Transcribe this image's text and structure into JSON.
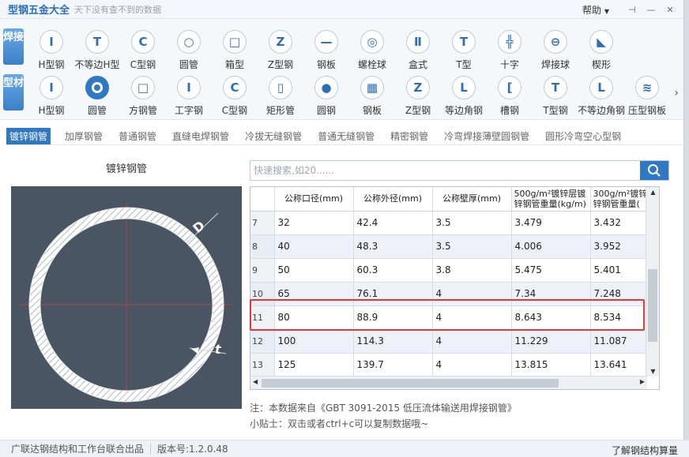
{
  "app": {
    "title": "型钢五金大全",
    "slogan": "天下没有查不到的数据",
    "help": "帮助",
    "help_arrow": "▼"
  },
  "categories": {
    "weld": "焊接",
    "profile": "型材"
  },
  "weld_items": [
    {
      "label": "H型钢",
      "icon": "I"
    },
    {
      "label": "不等边H型",
      "icon": "T"
    },
    {
      "label": "C型钢",
      "icon": "C"
    },
    {
      "label": "圆管",
      "icon": "○"
    },
    {
      "label": "箱型",
      "icon": "□"
    },
    {
      "label": "Z型钢",
      "icon": "Z"
    },
    {
      "label": "钢板",
      "icon": "—"
    },
    {
      "label": "螺栓球",
      "icon": "◎"
    },
    {
      "label": "盒式",
      "icon": "Ⅱ"
    },
    {
      "label": "T型",
      "icon": "T"
    },
    {
      "label": "十字",
      "icon": "╬"
    },
    {
      "label": "焊接球",
      "icon": "⊖"
    },
    {
      "label": "楔形",
      "icon": "◣"
    }
  ],
  "profile_items": [
    {
      "label": "H型钢",
      "icon": "I"
    },
    {
      "label": "圆管",
      "icon": "○"
    },
    {
      "label": "方钢管",
      "icon": "□"
    },
    {
      "label": "工字钢",
      "icon": "I"
    },
    {
      "label": "C型钢",
      "icon": "C"
    },
    {
      "label": "矩形管",
      "icon": "▯"
    },
    {
      "label": "圆钢",
      "icon": "●"
    },
    {
      "label": "钢板",
      "icon": "▦"
    },
    {
      "label": "Z型钢",
      "icon": "Z"
    },
    {
      "label": "等边角钢",
      "icon": "L"
    },
    {
      "label": "槽钢",
      "icon": "["
    },
    {
      "label": "T型钢",
      "icon": "T"
    },
    {
      "label": "不等边角钢",
      "icon": "L"
    },
    {
      "label": "压型钢板",
      "icon": "≋"
    }
  ],
  "subtabs": [
    "镀锌钢管",
    "加厚钢管",
    "普通钢管",
    "直缝电焊钢管",
    "冷拔无缝钢管",
    "普通无缝钢管",
    "精密钢管",
    "冷弯焊接薄壁圆钢管",
    "圆形冷弯空心型钢"
  ],
  "panel_title": "镀锌钢管",
  "diagram": {
    "label_d": "D",
    "label_t": "t"
  },
  "search": {
    "placeholder": "快速搜索,如20......"
  },
  "table": {
    "headers": [
      "公称口径(mm)",
      "公称外径(mm)",
      "公称壁厚(mm)",
      "500g/m²镀锌层镀|锌钢管重量(kg/m)",
      "300g/m²镀锌|锌钢管重量("
    ],
    "rows": [
      [
        "7",
        "32",
        "42.4",
        "3.5",
        "3.479",
        "3.432"
      ],
      [
        "8",
        "40",
        "48.3",
        "3.5",
        "4.006",
        "3.952"
      ],
      [
        "9",
        "50",
        "60.3",
        "3.8",
        "5.475",
        "5.401"
      ],
      [
        "10",
        "65",
        "76.1",
        "4",
        "7.34",
        "7.248"
      ],
      [
        "11",
        "80",
        "88.9",
        "4",
        "8.643",
        "8.534"
      ],
      [
        "12",
        "100",
        "114.3",
        "4",
        "11.229",
        "11.087"
      ],
      [
        "13",
        "125",
        "139.7",
        "4",
        "13.815",
        "13.641"
      ]
    ]
  },
  "notes": {
    "source": "注：本数据来自《GBT 3091-2015 低压流体输送用焊接钢管》",
    "tip": "小贴士：双击或者ctrl+c可以复制数据哦~"
  },
  "status": {
    "producer": "广联达钢结构和工作台联合出品",
    "version": "版本号:1.2.0.48",
    "right": "了解钢结构算量"
  }
}
